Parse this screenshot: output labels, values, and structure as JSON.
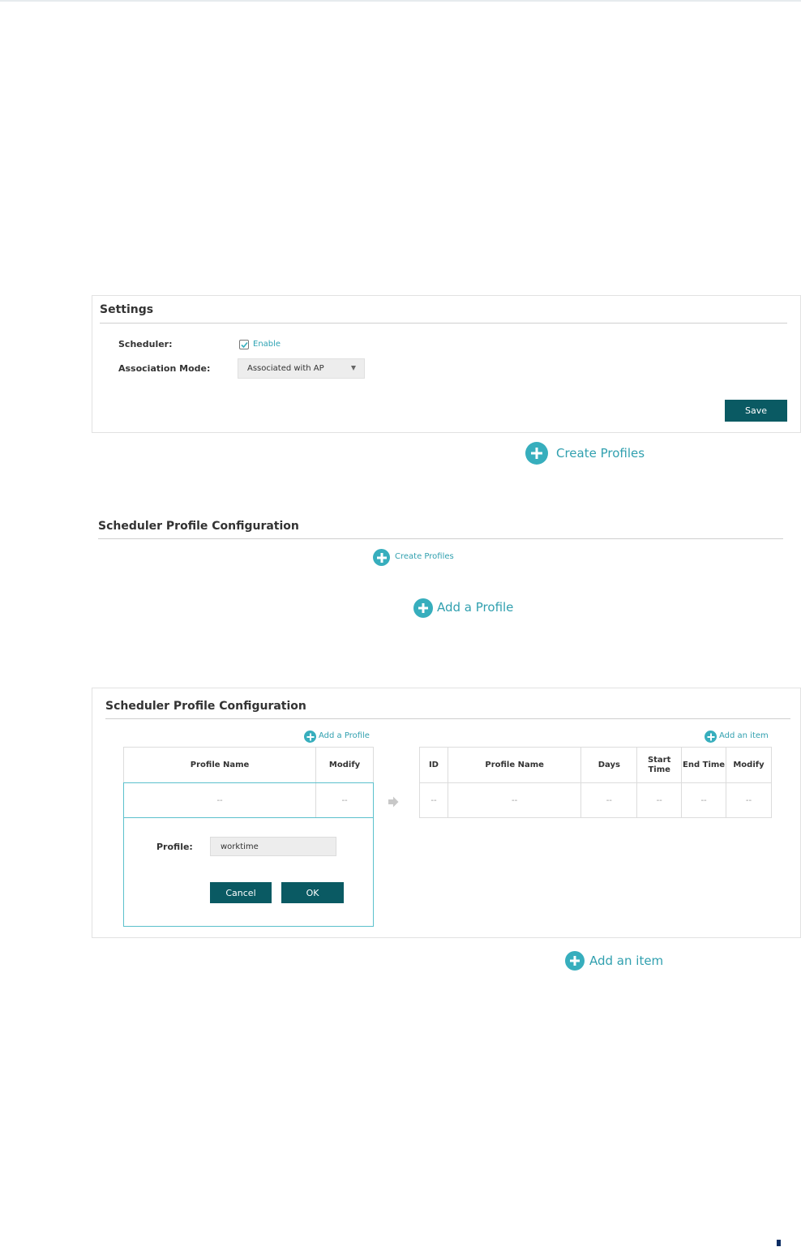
{
  "settings_panel": {
    "title": "Settings",
    "scheduler_label": "Scheduler:",
    "scheduler_enabled": true,
    "enable_label": "Enable",
    "association_label": "Association Mode:",
    "association_value": "Associated with AP",
    "save_label": "Save"
  },
  "callouts": {
    "create_profiles": "Create Profiles",
    "add_a_profile": "Add a Profile",
    "add_an_item": "Add an item"
  },
  "config_header": {
    "title": "Scheduler Profile Configuration",
    "create_profiles": "Create Profiles"
  },
  "config_panel": {
    "title": "Scheduler Profile Configuration",
    "add_profile_label": "Add a Profile",
    "add_item_label": "Add an item",
    "profile_table": {
      "headers": [
        "Profile Name",
        "Modify"
      ],
      "row": [
        "--",
        "--"
      ]
    },
    "profile_form": {
      "label": "Profile:",
      "value": "worktime",
      "cancel_label": "Cancel",
      "ok_label": "OK"
    },
    "item_table": {
      "headers": [
        "ID",
        "Profile Name",
        "Days",
        "Start Time",
        "End Time",
        "Modify"
      ],
      "row": [
        "--",
        "--",
        "--",
        "--",
        "--",
        "--"
      ]
    }
  },
  "colors": {
    "accent": "#37aebd",
    "button": "#0a5a63",
    "highlight_border": "#5bc0cc"
  },
  "icons": {
    "plus": "plus-circle-icon",
    "arrow": "arrow-right-icon",
    "check": "checkmark-icon"
  }
}
